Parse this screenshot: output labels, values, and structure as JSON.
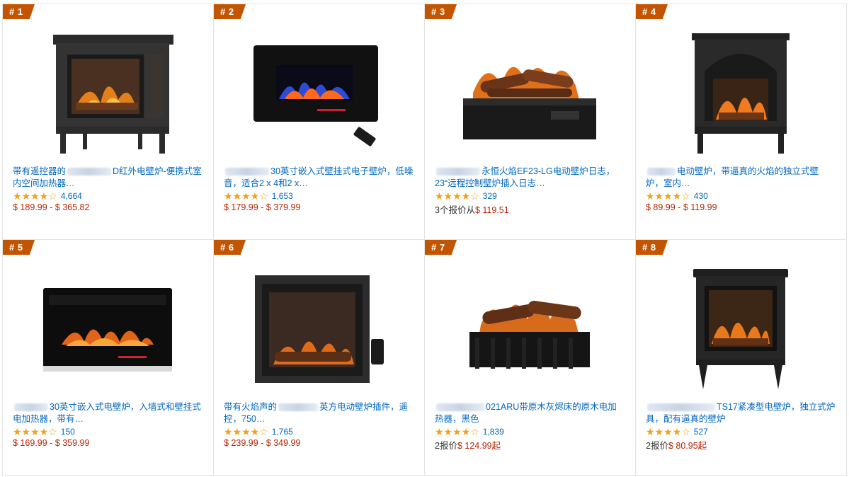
{
  "products": [
    {
      "rank": "# 1",
      "title_a": "带有遥控器的",
      "title_b": "D红外电壁炉-便携式室内空间加热器…",
      "rating_count": "4,664",
      "price": "$ 189.99 - $ 365.82",
      "stars": "★★★★☆"
    },
    {
      "rank": "# 2",
      "title_a": "",
      "title_b": "30英寸嵌入式壁挂式电子壁炉，低噪音，适合2 x 4和2 x…",
      "rating_count": "1,653",
      "price": "$ 179.99 - $ 379.99",
      "stars": "★★★★☆"
    },
    {
      "rank": "# 3",
      "title_a": "",
      "title_b": "永恒火焰EF23-LG电动壁炉日志，23“远程控制壁炉插入日志…",
      "rating_count": "329",
      "offer_prefix": "3个报价从",
      "price": "$ 119.51",
      "stars": "★★★★☆"
    },
    {
      "rank": "# 4",
      "title_a": "",
      "title_b": "电动壁炉，带逼真的火焰的独立式壁炉，室内…",
      "rating_count": "430",
      "price": "$ 89.99 - $ 119.99",
      "stars": "★★★★☆"
    },
    {
      "rank": "# 5",
      "title_a": "",
      "title_b": "30英寸嵌入式电壁炉，入墙式和壁挂式电加热器，带有…",
      "rating_count": "150",
      "price": "$ 169.99 - $ 359.99",
      "stars": "★★★★☆"
    },
    {
      "rank": "# 6",
      "title_a": "带有火焰声的",
      "title_b": "英方电动壁炉插件，遥控，750…",
      "rating_count": "1,765",
      "price": "$ 239.99 - $ 349.99",
      "stars": "★★★★☆"
    },
    {
      "rank": "# 7",
      "title_a": "",
      "title_b": "021ARU带原木灰烬床的原木电加热器，黑色",
      "rating_count": "1,839",
      "offer_prefix": "2报价",
      "price": "$ 124.99起",
      "stars": "★★★★☆"
    },
    {
      "rank": "# 8",
      "title_a": "",
      "title_b": "TS17紧凑型电壁炉，独立式炉具，配有逼真的壁炉",
      "rating_count": "527",
      "offer_prefix": "2报价",
      "price": "$ 80.95起",
      "stars": "★★★★☆"
    }
  ],
  "colors": {
    "badge": "#c45500",
    "link": "#0066c0",
    "price": "#b12704",
    "star": "#f0a21a"
  }
}
